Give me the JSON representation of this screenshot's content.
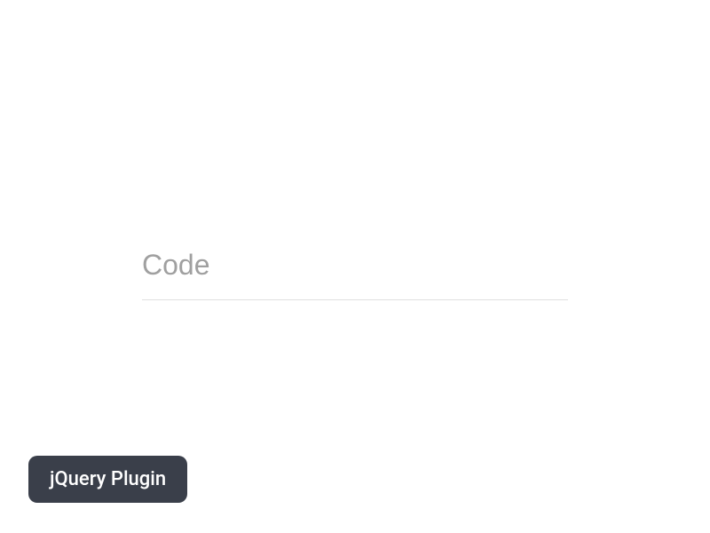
{
  "input": {
    "placeholder": "Code",
    "value": ""
  },
  "button": {
    "label": "jQuery Plugin"
  }
}
